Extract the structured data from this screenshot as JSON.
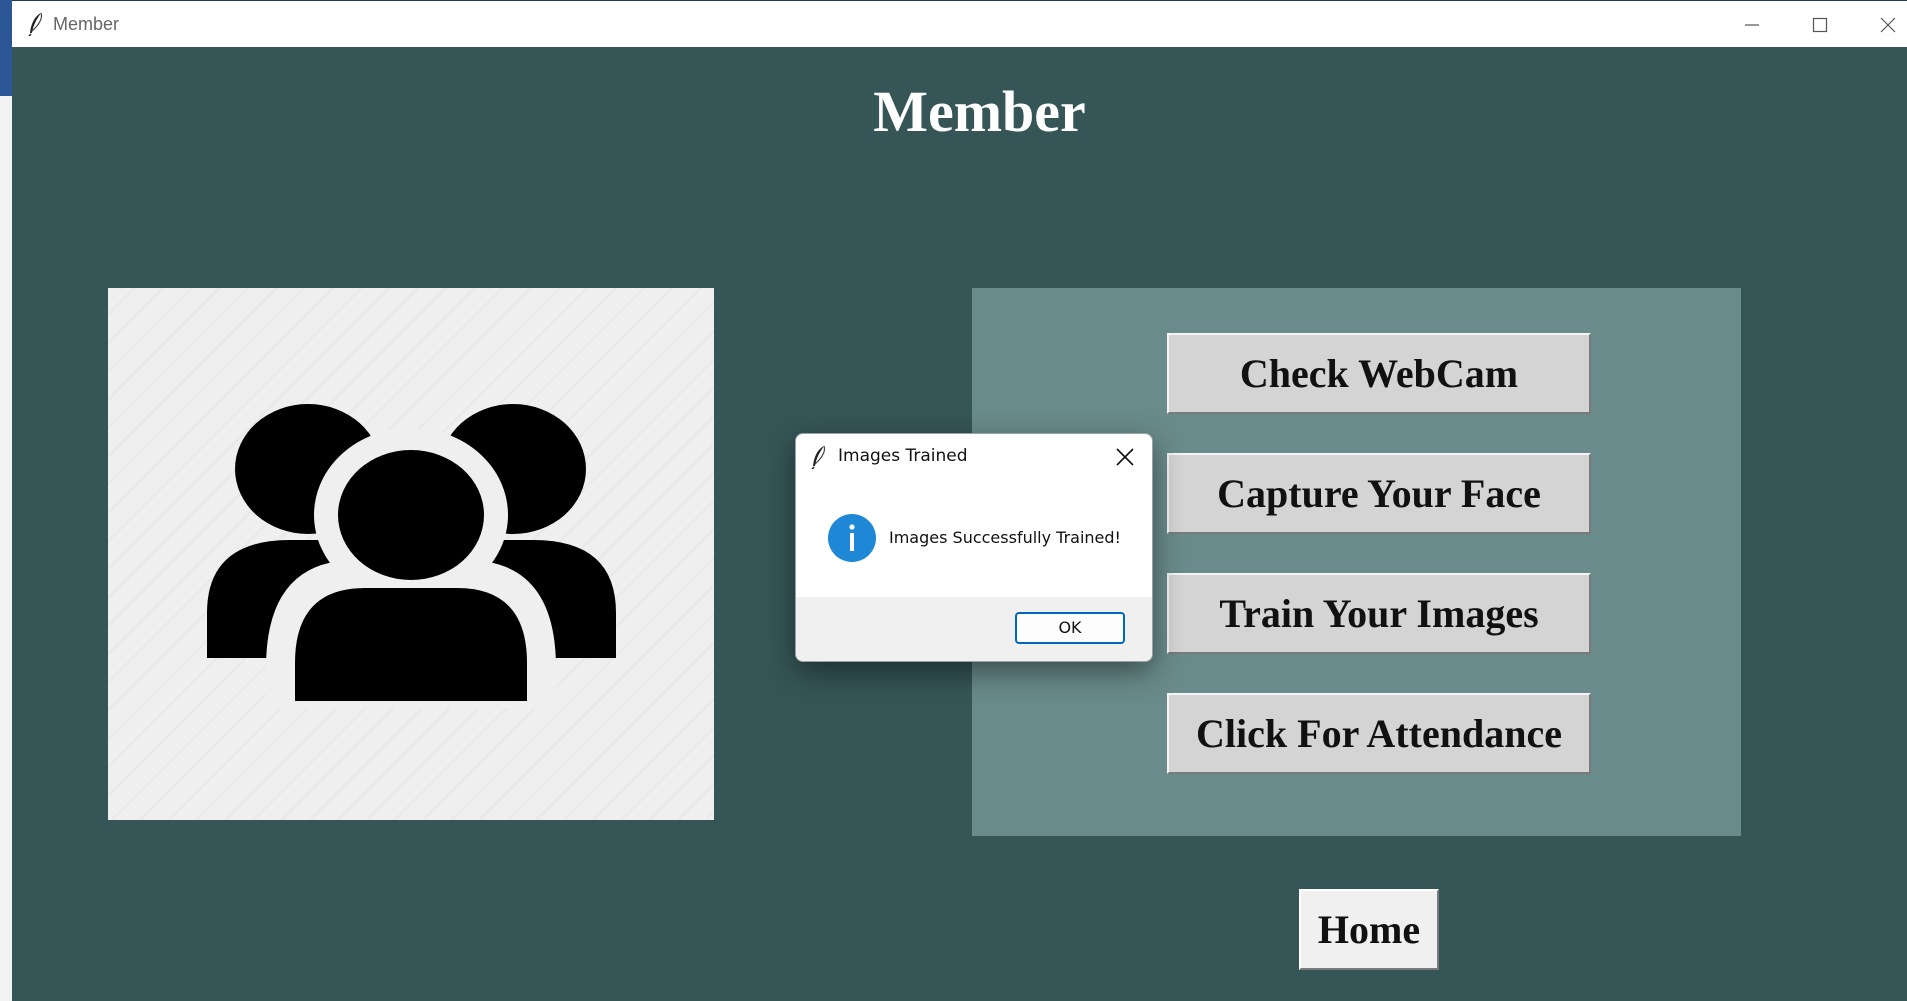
{
  "window": {
    "title": "Member",
    "heading": "Member"
  },
  "colors": {
    "window_bg": "#365557",
    "button_panel_bg": "#6a8b8b",
    "button_bg": "#d4d4d4",
    "dialog_accent": "#0067c0",
    "info_icon": "#1e88d6"
  },
  "image_panel": {
    "icon": "users-group-icon"
  },
  "actions": [
    {
      "label": "Check WebCam"
    },
    {
      "label": "Capture Your Face"
    },
    {
      "label": "Train Your Images"
    },
    {
      "label": "Click For Attendance"
    }
  ],
  "home_button": {
    "label": "Home"
  },
  "dialog": {
    "title": "Images Trained",
    "icon": "info-icon",
    "message": "Images Successfully Trained!",
    "ok_label": "OK"
  }
}
